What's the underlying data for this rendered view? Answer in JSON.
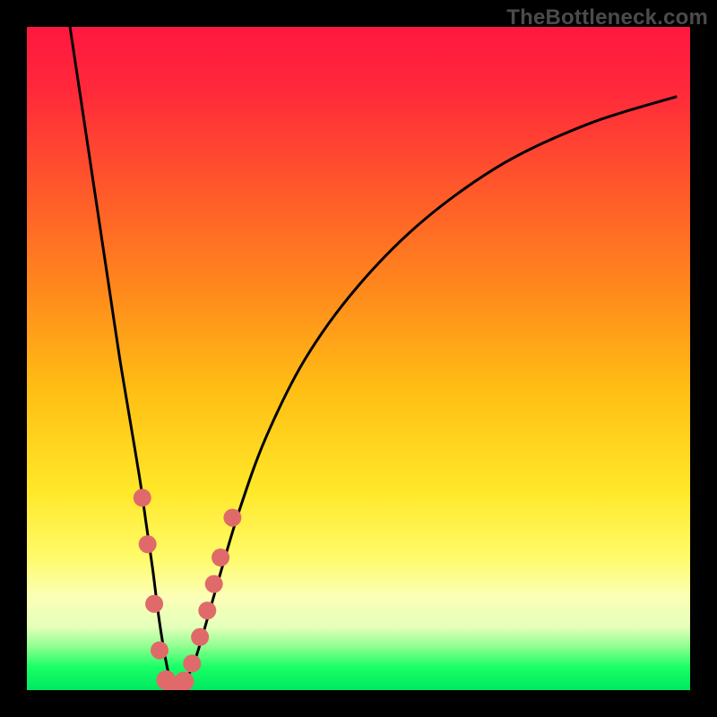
{
  "watermark": "TheBottleneck.com",
  "gradient": {
    "stops": [
      {
        "offset": 0.0,
        "color": "#ff173f"
      },
      {
        "offset": 0.1,
        "color": "#ff2a3a"
      },
      {
        "offset": 0.25,
        "color": "#ff5a2a"
      },
      {
        "offset": 0.4,
        "color": "#ff8a1c"
      },
      {
        "offset": 0.55,
        "color": "#ffbf14"
      },
      {
        "offset": 0.7,
        "color": "#ffe829"
      },
      {
        "offset": 0.8,
        "color": "#fffb6a"
      },
      {
        "offset": 0.86,
        "color": "#fbffb7"
      },
      {
        "offset": 0.905,
        "color": "#e4ffba"
      },
      {
        "offset": 0.935,
        "color": "#8dff8f"
      },
      {
        "offset": 0.965,
        "color": "#1aff66"
      },
      {
        "offset": 1.0,
        "color": "#00e860"
      }
    ]
  },
  "chart_data": {
    "type": "line",
    "title": "",
    "xlabel": "",
    "ylabel": "",
    "xlim": [
      0,
      100
    ],
    "ylim": [
      0,
      100
    ],
    "series": [
      {
        "name": "bottleneck-curve",
        "x": [
          6.5,
          8,
          9.5,
          11,
          12.5,
          14,
          15.5,
          17,
          18,
          19,
          19.75,
          20.5,
          21.25,
          22,
          23,
          24,
          25.5,
          27,
          29,
          32,
          36,
          42,
          50,
          60,
          72,
          85,
          98
        ],
        "values": [
          100,
          90,
          80,
          70,
          60,
          50,
          41,
          32,
          25,
          18,
          12,
          7,
          3,
          0.5,
          0.3,
          1.5,
          5,
          10,
          17,
          27,
          38,
          50,
          61,
          71,
          79.5,
          85.5,
          89.5
        ]
      }
    ],
    "markers": {
      "name": "data-points",
      "color": "#e06a6a",
      "points": [
        {
          "x": 17.4,
          "y": 29,
          "r": 10
        },
        {
          "x": 18.2,
          "y": 22,
          "r": 10
        },
        {
          "x": 19.2,
          "y": 13,
          "r": 10
        },
        {
          "x": 20.0,
          "y": 6,
          "r": 10
        },
        {
          "x": 21.0,
          "y": 1.5,
          "r": 11
        },
        {
          "x": 22.3,
          "y": 0.5,
          "r": 11
        },
        {
          "x": 23.7,
          "y": 1.3,
          "r": 11
        },
        {
          "x": 24.9,
          "y": 4,
          "r": 10
        },
        {
          "x": 26.1,
          "y": 8,
          "r": 10
        },
        {
          "x": 27.2,
          "y": 12,
          "r": 10
        },
        {
          "x": 28.2,
          "y": 16,
          "r": 10
        },
        {
          "x": 29.2,
          "y": 20,
          "r": 10
        },
        {
          "x": 31.0,
          "y": 26,
          "r": 10
        }
      ]
    }
  }
}
